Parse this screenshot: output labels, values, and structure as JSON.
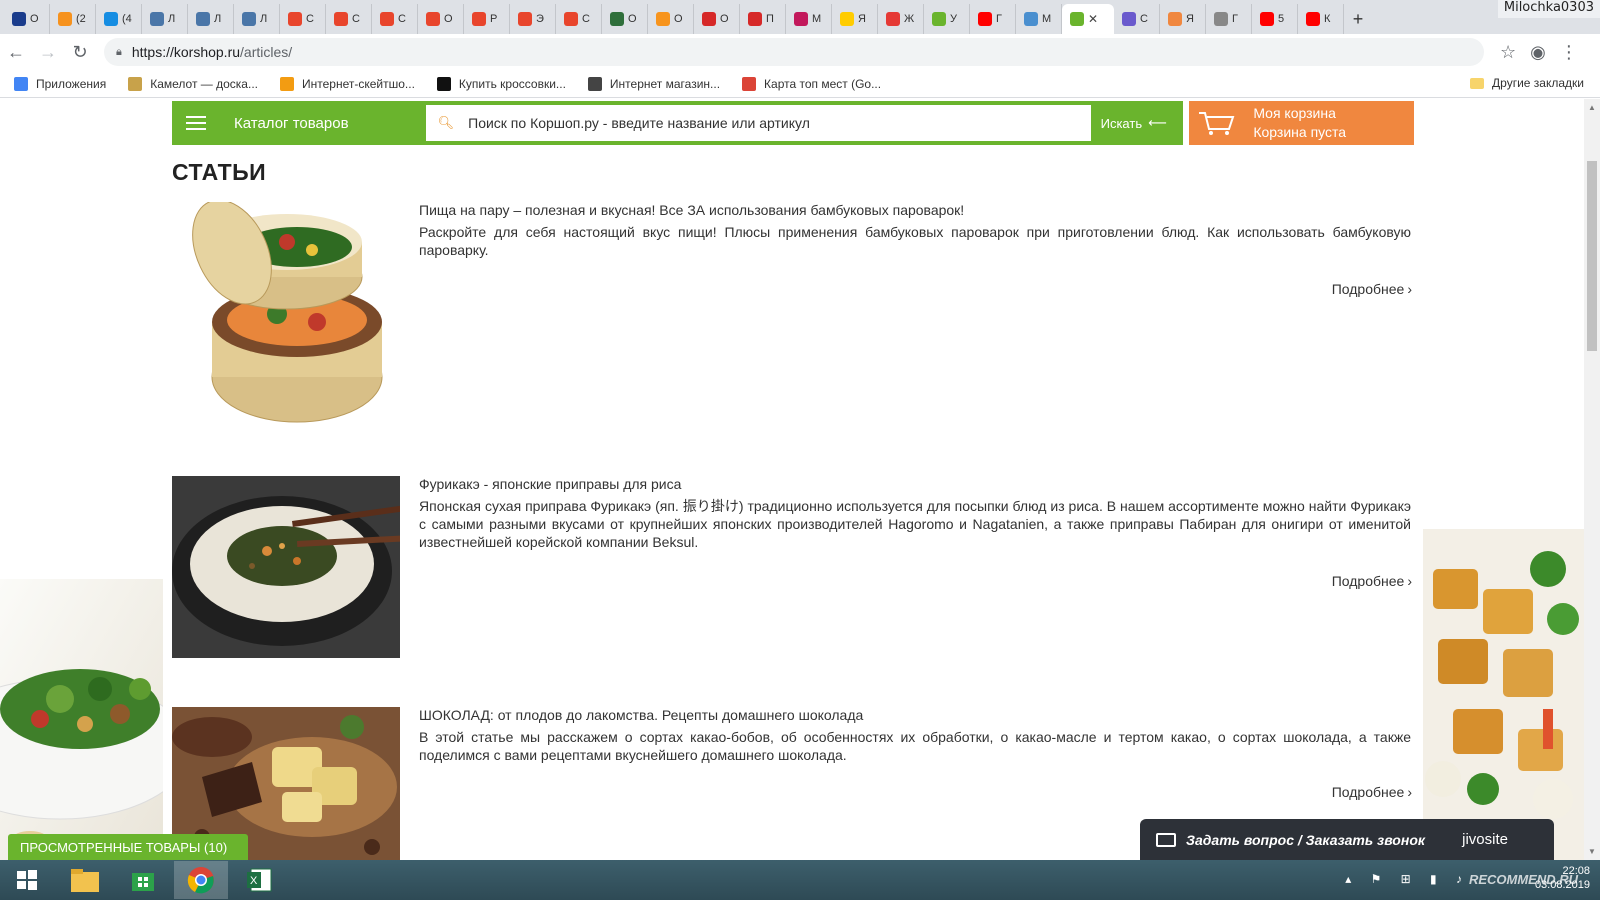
{
  "browser": {
    "tabs": [
      {
        "letter": "О",
        "color": "#1a3c8c"
      },
      {
        "letter": "(2",
        "color": "#f6921e"
      },
      {
        "letter": "(4",
        "color": "#168de2"
      },
      {
        "letter": "Л",
        "color": "#4a76a8"
      },
      {
        "letter": "Л",
        "color": "#4a76a8"
      },
      {
        "letter": "Л",
        "color": "#4a76a8"
      },
      {
        "letter": "С",
        "color": "#e8452c"
      },
      {
        "letter": "С",
        "color": "#e8452c"
      },
      {
        "letter": "С",
        "color": "#e8452c"
      },
      {
        "letter": "О",
        "color": "#e8452c"
      },
      {
        "letter": "Р",
        "color": "#e8452c"
      },
      {
        "letter": "Э",
        "color": "#e8452c"
      },
      {
        "letter": "С",
        "color": "#e8452c"
      },
      {
        "letter": "О",
        "color": "#2f6f3b"
      },
      {
        "letter": "О",
        "color": "#f7941d"
      },
      {
        "letter": "О",
        "color": "#d62828"
      },
      {
        "letter": "П",
        "color": "#d62828"
      },
      {
        "letter": "М",
        "color": "#c2185b"
      },
      {
        "letter": "Я",
        "color": "#ffcc00"
      },
      {
        "letter": "Ж",
        "color": "#e53935"
      },
      {
        "letter": "У",
        "color": "#6ab42d"
      },
      {
        "letter": "Г",
        "color": "#ff0000"
      },
      {
        "letter": "М",
        "color": "#4a8fcf"
      }
    ],
    "active_tab_color": "#6ab42d",
    "tabs_after": [
      {
        "letter": "С",
        "color": "#6a5acd"
      },
      {
        "letter": "Я",
        "color": "#f0873f"
      },
      {
        "letter": "Г",
        "color": "#888888"
      },
      {
        "letter": "5",
        "color": "#ff0000"
      },
      {
        "letter": "К",
        "color": "#ff0000"
      }
    ],
    "close_glyph": "✕",
    "new_tab_glyph": "+",
    "user_name": "Milochka0303",
    "url_host": "https://korshop.ru",
    "url_path": "/articles/",
    "bookmarks": [
      {
        "label": "Приложения",
        "color": "#4285f4"
      },
      {
        "label": "Камелот — доска...",
        "color": "#c8a24a"
      },
      {
        "label": "Интернет-скейтшо...",
        "color": "#f39c12"
      },
      {
        "label": "Купить кроссовки...",
        "color": "#111111"
      },
      {
        "label": "Интернет магазин...",
        "color": "#444444"
      },
      {
        "label": "Карта топ мест (Go...",
        "color": "#db4437"
      }
    ],
    "other_bookmarks": "Другие закладки"
  },
  "site": {
    "catalog_label": "Каталог товаров",
    "search_placeholder": "Поиск по Коршоп.ру - введите название или артикул",
    "search_button": "Искать",
    "cart_title": "Моя корзина",
    "cart_status": "Корзина пуста",
    "brand_green": "#6ab42d",
    "brand_orange": "#f0873f"
  },
  "page": {
    "title": "СТАТЬИ",
    "more_label": "Подробнее",
    "articles": [
      {
        "title": "Пища на пару – полезная и вкусная! Все ЗА использования бамбуковых пароварок!",
        "text": "Раскройте для себя настоящий вкус пищи! Плюсы применения бамбуковых пароварок при приготовлении блюд. Как использовать бамбуковую пароварку."
      },
      {
        "title": "Фурикакэ - японские приправы для риса",
        "text": "Японская сухая приправа Фурикакэ (яп. 振り掛け) традиционно используется для посыпки блюд из риса. В нашем ассортименте можно найти Фурикакэ с самыми разными вкусами от крупнейших японских производителей Hagoromo и Nagatanien, а  также приправы Пабиран для онигири от именитой известнейшей корейской компании Beksul."
      },
      {
        "title": "ШОКОЛАД: от плодов до лакомства. Рецепты домашнего шоколада",
        "text": "В этой статье мы расскажем о сортах какао-бобов, об особенностях их обработки, о какао-масле и тертом какао, о сортах шоколада, а также поделимся с вами рецептами вкуснейшего домашнего шоколада."
      }
    ],
    "viewed_products": "ПРОСМОТРЕННЫЕ ТОВАРЫ (10)",
    "chat_label": "Задать вопрос / Заказать звонок",
    "chat_brand": "jivosite"
  },
  "taskbar": {
    "time": "22:08",
    "date": "03.08.2019",
    "watermark": "RECOMMEND.RU"
  }
}
